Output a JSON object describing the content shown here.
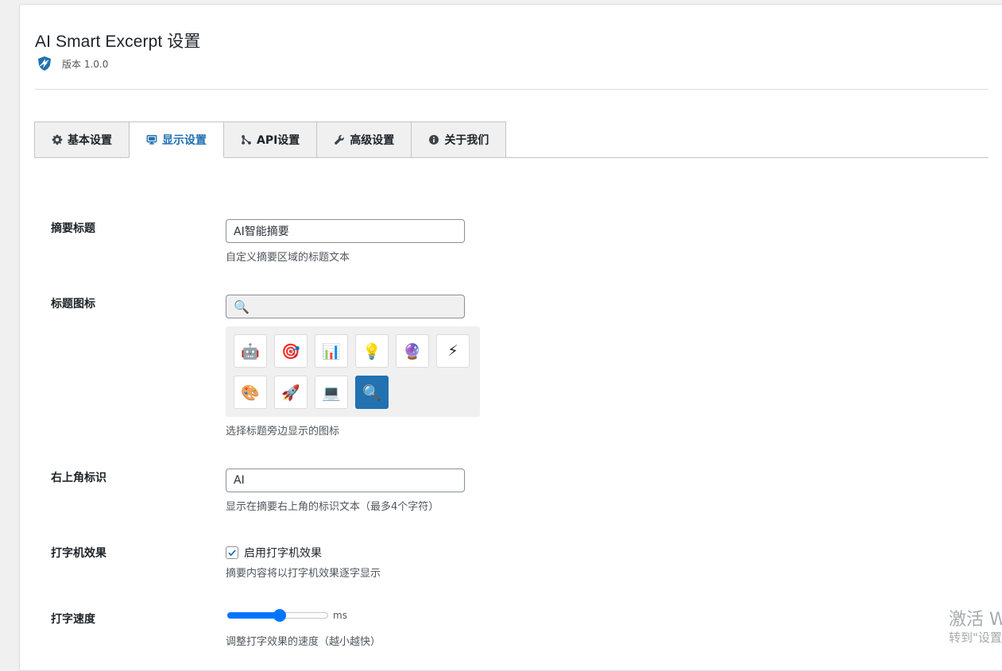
{
  "header": {
    "title": "AI Smart Excerpt 设置",
    "version": "版本 1.0.0",
    "logo_icon": "shield-bolt-icon"
  },
  "tabs": [
    {
      "label": "基本设置",
      "icon": "gear-icon",
      "active": false
    },
    {
      "label": "显示设置",
      "icon": "monitor-icon",
      "active": true
    },
    {
      "label": "API设置",
      "icon": "connection-icon",
      "active": false
    },
    {
      "label": "高级设置",
      "icon": "wrench-icon",
      "active": false
    },
    {
      "label": "关于我们",
      "icon": "info-icon",
      "active": false
    }
  ],
  "fields": {
    "summary_title": {
      "label": "摘要标题",
      "value": "AI智能摘要",
      "desc": "自定义摘要区域的标题文本"
    },
    "title_icon": {
      "label": "标题图标",
      "current": "🔍",
      "icons": [
        "🤖",
        "🎯",
        "📊",
        "💡",
        "🔮",
        "⚡",
        "🎨",
        "🚀",
        "💻",
        "🔍"
      ],
      "selected_index": 9,
      "desc": "选择标题旁边显示的图标"
    },
    "corner_badge": {
      "label": "右上角标识",
      "value": "AI",
      "desc": "显示在摘要右上角的标识文本（最多4个字符）"
    },
    "typewriter": {
      "label": "打字机效果",
      "checkbox_label": "启用打字机效果",
      "checked": true,
      "desc": "摘要内容将以打字机效果逐字显示"
    },
    "typing_speed": {
      "label": "打字速度",
      "unit": "ms",
      "level_fraction": 0.52,
      "desc": "调整打字效果的速度（越小越快）"
    }
  },
  "watermark": {
    "line1": "激活 W",
    "line2": "转到\"设置"
  },
  "colors": {
    "accent": "#2271b1",
    "slider": "#0075ff"
  }
}
